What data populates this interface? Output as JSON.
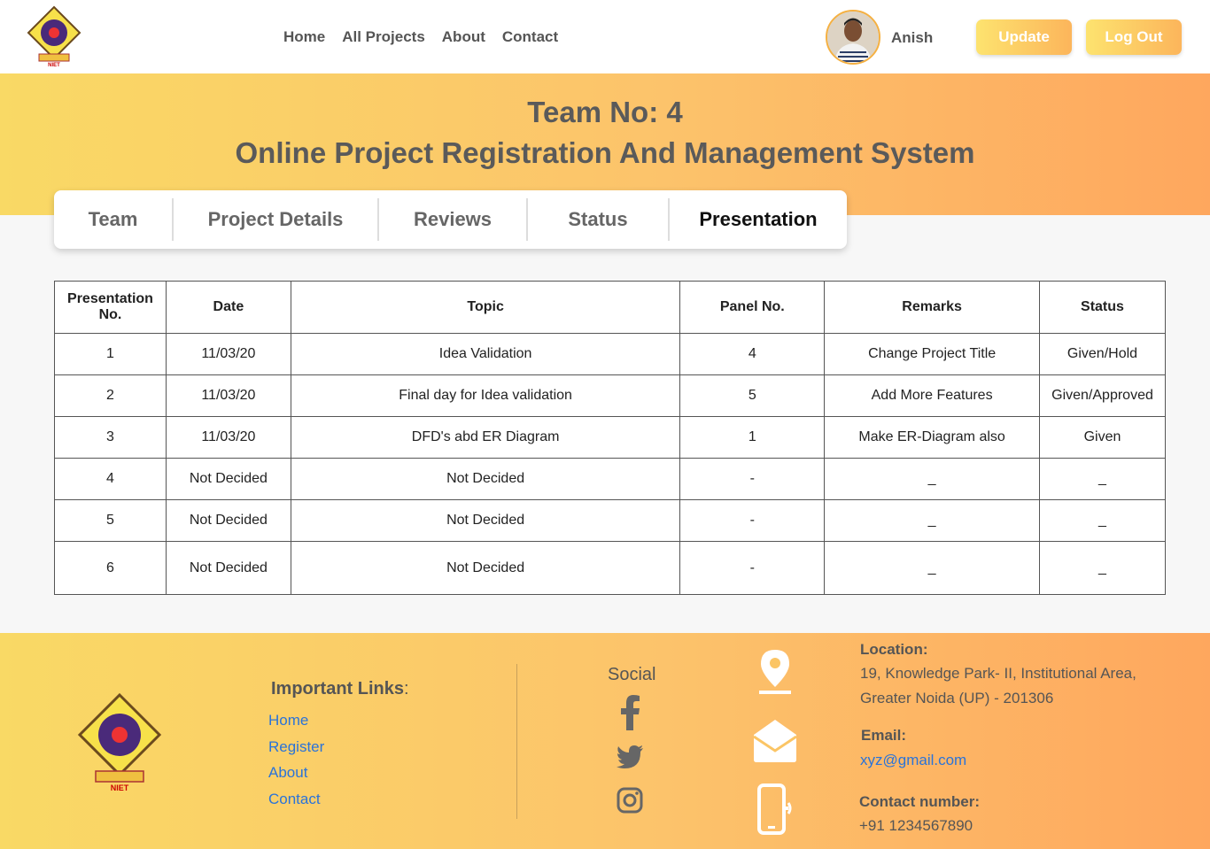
{
  "header": {
    "nav": [
      "Home",
      "All Projects",
      "About",
      "Contact"
    ],
    "user_name": "Anish",
    "update_label": "Update",
    "logout_label": "Log Out"
  },
  "banner": {
    "team_title": "Team No: 4",
    "project_title": "Online Project Registration And Management System"
  },
  "tabs": [
    "Team",
    "Project Details",
    "Reviews",
    "Status",
    "Presentation"
  ],
  "active_tab": "Presentation",
  "table": {
    "headers": [
      "Presentation No.",
      "Date",
      "Topic",
      "Panel No.",
      "Remarks",
      "Status"
    ],
    "rows": [
      [
        "1",
        "11/03/20",
        "Idea Validation",
        "4",
        "Change Project Title",
        "Given/Hold"
      ],
      [
        "2",
        "11/03/20",
        "Final day for Idea validation",
        "5",
        "Add More Features",
        "Given/Approved"
      ],
      [
        "3",
        "11/03/20",
        "DFD's abd ER Diagram",
        "1",
        "Make ER-Diagram also",
        "Given"
      ],
      [
        "4",
        "Not Decided",
        "Not Decided",
        "-",
        "_",
        "_"
      ],
      [
        "5",
        "Not Decided",
        "Not Decided",
        "-",
        "_",
        "_"
      ],
      [
        "6",
        "Not Decided",
        "Not Decided",
        "-",
        "_",
        "_"
      ]
    ]
  },
  "footer": {
    "links_title": "Important Links",
    "links": [
      "Home",
      "Register",
      "About",
      "Contact"
    ],
    "social_title": "Social",
    "location_label": "Location:",
    "location_line1": "19, Knowledge Park- II, Institutional Area,",
    "location_line2": "Greater Noida (UP) - 201306",
    "email_label": "Email:",
    "email": "xyz@gmail.com",
    "contact_label": "Contact number:",
    "contact": "+91 1234567890"
  },
  "colors": {
    "gradient_start": "#f9d965",
    "gradient_end": "#fea75e",
    "link_blue": "#2a73d9"
  }
}
